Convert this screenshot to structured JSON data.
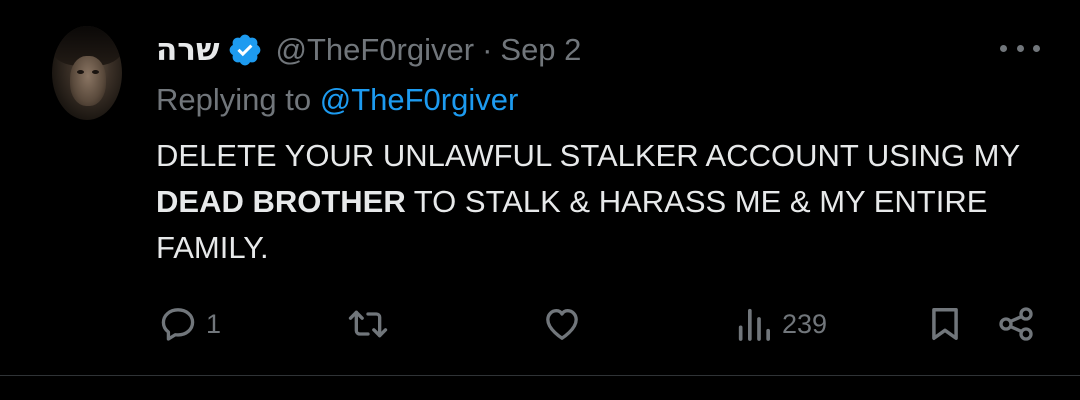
{
  "tweet": {
    "author_name": "שרה",
    "verified_icon": "verified-badge-icon",
    "handle": "@TheF0rgiver",
    "separator": "·",
    "date": "Sep 2",
    "replying_prefix": "Replying to",
    "replying_mention": "@TheF0rgiver",
    "body_part1": "DELETE YOUR UNLAWFUL STALKER ACCOUNT USING MY ",
    "body_bold": "DEAD BROTHER",
    "body_part2": " TO STALK & HARASS ME & MY ENTIRE FAMILY."
  },
  "actions": {
    "reply_count": "1",
    "views_count": "239",
    "icons": [
      "reply-icon",
      "retweet-icon",
      "like-icon",
      "views-icon",
      "bookmark-icon",
      "share-icon"
    ]
  },
  "colors": {
    "background": "#000000",
    "text": "#e7e9ea",
    "muted": "#71767b",
    "accent": "#1d9bf0",
    "divider": "#2f3336"
  }
}
